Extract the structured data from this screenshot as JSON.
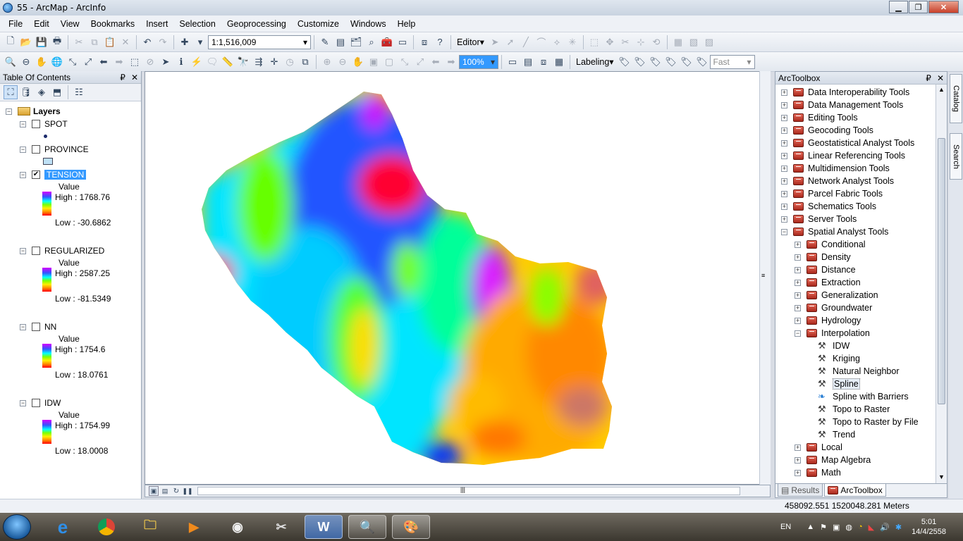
{
  "window": {
    "title": "55 - ArcMap - ArcInfo",
    "minimize": "▁",
    "maximize": "❐",
    "close": "✕"
  },
  "menu": [
    "File",
    "Edit",
    "View",
    "Bookmarks",
    "Insert",
    "Selection",
    "Geoprocessing",
    "Customize",
    "Windows",
    "Help"
  ],
  "toolbar": {
    "scale": "1:1,516,009",
    "editor_label": "Editor",
    "zoom_percent": "100%",
    "labeling_label": "Labeling",
    "quality": "Fast"
  },
  "toc": {
    "title": "Table Of Contents",
    "pin": "₽",
    "close": "✕",
    "root": "Layers",
    "layers": [
      {
        "name": "SPOT",
        "checked": false
      },
      {
        "name": "PROVINCE",
        "checked": false
      },
      {
        "name": "TENSION",
        "checked": true,
        "selected": true,
        "value_label": "Value",
        "high": "High : 1768.76",
        "low": "Low : -30.6862"
      },
      {
        "name": "REGULARIZED",
        "checked": false,
        "value_label": "Value",
        "high": "High : 2587.25",
        "low": "Low : -81.5349"
      },
      {
        "name": "NN",
        "checked": false,
        "value_label": "Value",
        "high": "High : 1754.6",
        "low": "Low : 18.0761"
      },
      {
        "name": "IDW",
        "checked": false,
        "value_label": "Value",
        "high": "High : 1754.99",
        "low": "Low : 18.0008"
      }
    ]
  },
  "arctoolbox": {
    "title": "ArcToolbox",
    "pin": "₽",
    "close": "✕",
    "toolboxes": [
      "Data Interoperability Tools",
      "Data Management Tools",
      "Editing Tools",
      "Geocoding Tools",
      "Geostatistical Analyst Tools",
      "Linear Referencing Tools",
      "Multidimension Tools",
      "Network Analyst Tools",
      "Parcel Fabric Tools",
      "Schematics Tools",
      "Server Tools",
      "Spatial Analyst Tools"
    ],
    "spatial_sets": [
      "Conditional",
      "Density",
      "Distance",
      "Extraction",
      "Generalization",
      "Groundwater",
      "Hydrology",
      "Interpolation"
    ],
    "interp_tools": [
      "IDW",
      "Kriging",
      "Natural Neighbor",
      "Spline",
      "Spline with Barriers",
      "Topo to Raster",
      "Topo to Raster by File",
      "Trend"
    ],
    "spatial_after": [
      "Local",
      "Map Algebra",
      "Math"
    ],
    "tabs": [
      "Results",
      "ArcToolbox"
    ]
  },
  "side_tabs": [
    "Catalog",
    "Search"
  ],
  "status": {
    "coordinates": "458092.551  1520048.281 Meters"
  },
  "taskbar": {
    "lang": "EN",
    "time": "5:01",
    "date": "14/4/2558"
  }
}
